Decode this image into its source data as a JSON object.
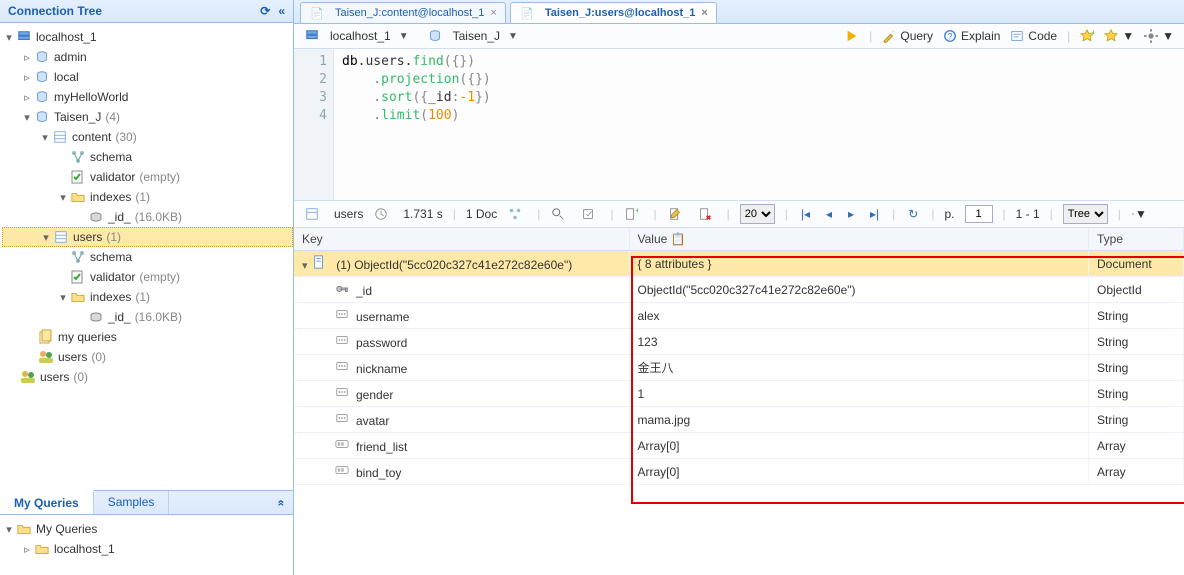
{
  "sidebar": {
    "title": "Connection Tree",
    "nodes": {
      "host": "localhost_1",
      "dbs": [
        "admin",
        "local",
        "myHelloWorld"
      ],
      "taisen": {
        "label": "Taisen_J",
        "count": "(4)"
      },
      "content": {
        "label": "content",
        "count": "(30)"
      },
      "schema": "schema",
      "validator": "validator",
      "validator_empty": "(empty)",
      "indexes": {
        "label": "indexes",
        "count": "(1)"
      },
      "id_index": {
        "label": "_id_",
        "size": "(16.0KB)"
      },
      "users": {
        "label": "users",
        "count": "(1)"
      },
      "my_queries": "my queries",
      "users0": {
        "label": "users",
        "count": "(0)"
      },
      "users0b": {
        "label": "users",
        "count": "(0)"
      }
    },
    "myqueries": {
      "tab1": "My Queries",
      "tab2": "Samples",
      "root": "My Queries",
      "child": "localhost_1"
    }
  },
  "tabs": [
    {
      "label": "Taisen_J:content@localhost_1"
    },
    {
      "label": "Taisen_J:users@localhost_1"
    }
  ],
  "path": {
    "host": "localhost_1",
    "db": "Taisen_J"
  },
  "toolbar": {
    "query": "Query",
    "explain": "Explain",
    "code": "Code"
  },
  "editor": {
    "lines": [
      "1",
      "2",
      "3",
      "4"
    ],
    "l1a": "db",
    "l1b": ".users.",
    "l1c": "find",
    "l1d": "({})",
    "l2a": "    .",
    "l2b": "projection",
    "l2c": "({})",
    "l3a": "    .",
    "l3b": "sort",
    "l3c": "({",
    "l3d": "_id",
    "l3e": ":",
    "l3f": "-1",
    "l3g": "})",
    "l4a": "    .",
    "l4b": "limit",
    "l4c": "(",
    "l4d": "100",
    "l4e": ")"
  },
  "resultbar": {
    "coll": "users",
    "time": "1.731 s",
    "docs": "1 Doc",
    "pagesize": "20",
    "page_label": "p.",
    "page": "1",
    "range": "1 - 1",
    "view": "Tree"
  },
  "grid": {
    "cols": {
      "key": "Key",
      "value": "Value",
      "type": "Type"
    },
    "doc": {
      "key": "(1) ObjectId(\"5cc020c327c41e272c82e60e\")",
      "val": "{ 8 attributes }",
      "type": "Document"
    },
    "rows": [
      {
        "k": "_id",
        "v": "ObjectId(\"5cc020c327c41e272c82e60e\")",
        "t": "ObjectId",
        "icon": "key"
      },
      {
        "k": "username",
        "v": "alex",
        "t": "String",
        "icon": "str"
      },
      {
        "k": "password",
        "v": "123",
        "t": "String",
        "icon": "str"
      },
      {
        "k": "nickname",
        "v": "金王八",
        "t": "String",
        "icon": "str"
      },
      {
        "k": "gender",
        "v": "1",
        "t": "String",
        "icon": "str"
      },
      {
        "k": "avatar",
        "v": "mama.jpg",
        "t": "String",
        "icon": "str"
      },
      {
        "k": "friend_list",
        "v": "Array[0]",
        "t": "Array",
        "icon": "arr"
      },
      {
        "k": "bind_toy",
        "v": "Array[0]",
        "t": "Array",
        "icon": "arr"
      }
    ]
  },
  "chart_data": {
    "type": "table",
    "title": "users document fields",
    "columns": [
      "Key",
      "Value",
      "Type"
    ],
    "rows": [
      [
        "_id",
        "ObjectId(\"5cc020c327c41e272c82e60e\")",
        "ObjectId"
      ],
      [
        "username",
        "alex",
        "String"
      ],
      [
        "password",
        "123",
        "String"
      ],
      [
        "nickname",
        "金王八",
        "String"
      ],
      [
        "gender",
        "1",
        "String"
      ],
      [
        "avatar",
        "mama.jpg",
        "String"
      ],
      [
        "friend_list",
        "Array[0]",
        "Array"
      ],
      [
        "bind_toy",
        "Array[0]",
        "Array"
      ]
    ]
  }
}
